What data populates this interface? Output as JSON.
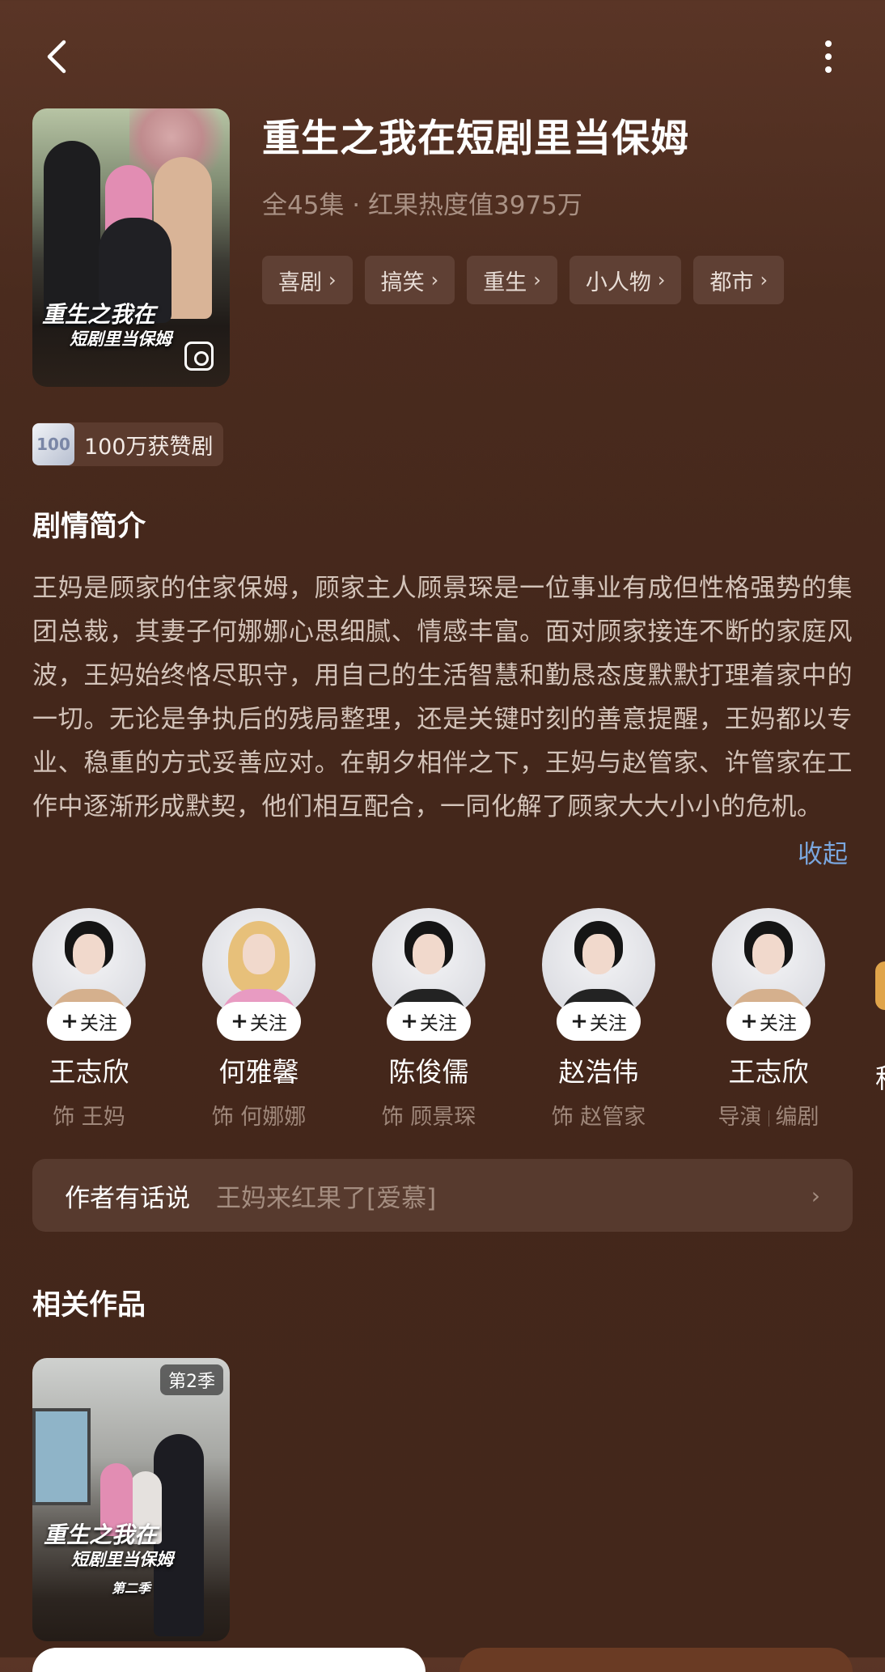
{
  "header": {
    "back_icon": "chevron-left-icon",
    "more_icon": "more-vertical-icon"
  },
  "show": {
    "poster_title_line1": "重生之我在",
    "poster_title_line2": "短剧里当保姆",
    "title": "重生之我在短剧里当保姆",
    "meta": "全45集 · 红果热度值3975万",
    "tags": [
      "喜剧",
      "搞笑",
      "重生",
      "小人物",
      "都市"
    ]
  },
  "award": {
    "icon_text": "100",
    "label": "100万获赞剧"
  },
  "synopsis": {
    "heading": "剧情简介",
    "text": "王妈是顾家的住家保姆，顾家主人顾景琛是一位事业有成但性格强势的集团总裁，其妻子何娜娜心思细腻、情感丰富。面对顾家接连不断的家庭风波，王妈始终恪尽职守，用自己的生活智慧和勤恳态度默默打理着家中的一切。无论是争执后的残局整理，还是关键时刻的善意提醒，王妈都以专业、稳重的方式妥善应对。在朝夕相伴之下，王妈与赵管家、许管家在工作中逐渐形成默契，他们相互配合，一同化解了顾家大大小小的危机。",
    "collapse_label": "收起"
  },
  "cast": {
    "follow_label": "关注",
    "members": [
      {
        "name": "王志欣",
        "role": "饰 王妈"
      },
      {
        "name": "何雅馨",
        "role": "饰 何娜娜"
      },
      {
        "name": "陈俊儒",
        "role": "饰 顾景琛"
      },
      {
        "name": "赵浩伟",
        "role": "饰 赵管家"
      },
      {
        "name": "王志欣",
        "role_a": "导演",
        "role_b": "编剧"
      }
    ],
    "peek_name": "程"
  },
  "author_note": {
    "label": "作者有话说",
    "text": "王妈来红果了[爱慕]"
  },
  "related": {
    "heading": "相关作品",
    "items": [
      {
        "badge": "第2季",
        "title_line1": "重生之我在",
        "title_line2": "短剧里当保姆",
        "title_line3": "第二季"
      }
    ]
  },
  "colors": {
    "background": "#4a2b1e",
    "tag_bg": "#5f4034",
    "link": "#7aa6de",
    "muted_text": "#a99184"
  }
}
